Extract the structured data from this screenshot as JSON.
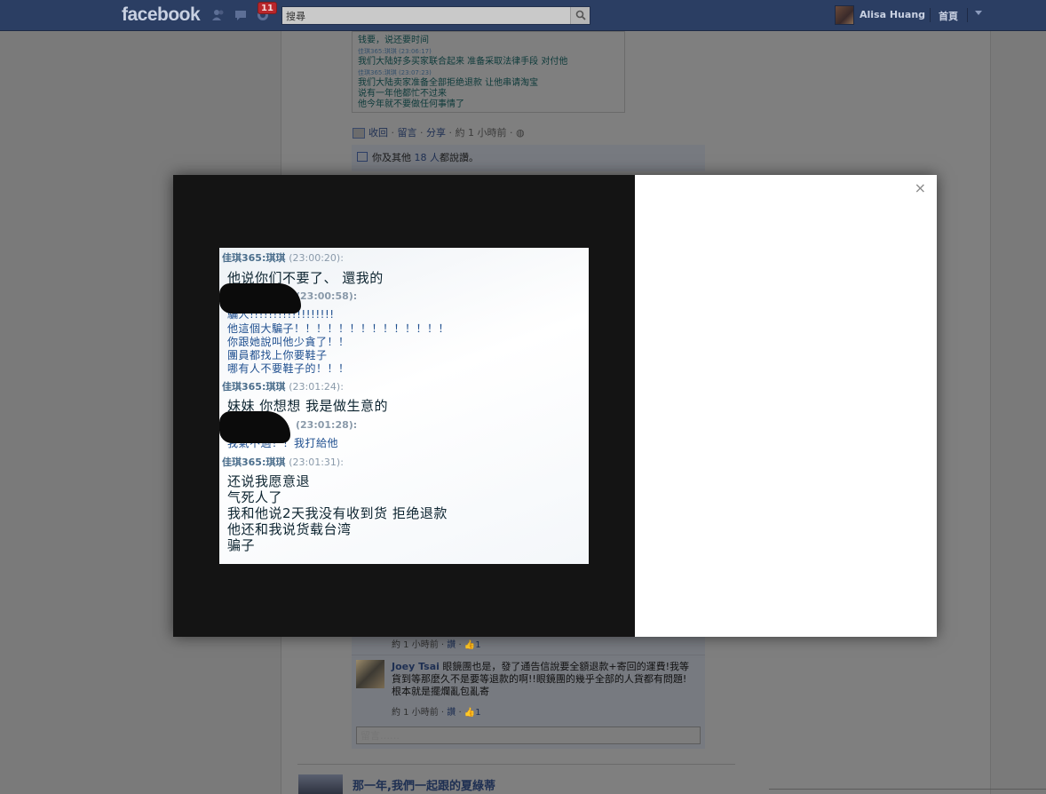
{
  "topbar": {
    "logo": "facebook",
    "notification_count": "11",
    "search": {
      "value": "搜尋",
      "placeholder": "搜尋"
    },
    "user_name": "Alisa Huang",
    "home_label": "首頁"
  },
  "post": {
    "chat_lines": [
      {
        "type": "msg",
        "text": "钱要，说还要时间"
      },
      {
        "type": "name",
        "text": "佳琪365:琪琪 (23:06:17)"
      },
      {
        "type": "msg",
        "text": "我们大陆好多买家联合起来 准备采取法律手段 对付他"
      },
      {
        "type": "name",
        "text": "佳琪365:琪琪 (23:07:23)"
      },
      {
        "type": "msg",
        "text": "我们大陆卖家准备全部拒绝退款 让他串请淘宝"
      },
      {
        "type": "msg",
        "text": "说有一年他都忙不过来"
      },
      {
        "type": "msg",
        "text": "他今年就不要做任何事情了"
      }
    ],
    "actions": {
      "collapse": "收回",
      "comment": "留言",
      "share": "分享",
      "time": "約 1 小時前"
    },
    "likes_text_prefix": "你及其他 ",
    "likes_link": "18 人",
    "likes_text_suffix": "都說讚。"
  },
  "comments": [
    {
      "author": "",
      "text": "",
      "meta_time": "約 1 小時前",
      "meta_like": "讚",
      "meta_count": "1"
    },
    {
      "author": "Joey Tsai",
      "text": "眼鏡團也是，發了通告信說要全額退款+寄回的運費!我等貨到等那麼久不是要等退款的啊!!眼鏡團的幾乎全部的人貨都有問題!根本就是擺爛亂包亂寄",
      "meta_time": "約 1 小時前",
      "meta_like": "讚",
      "meta_count": "1"
    }
  ],
  "comment_input": {
    "placeholder": "留言……"
  },
  "next_post": {
    "title": "那一年,我們一起跟的夏綠蒂"
  },
  "modal": {
    "close": "×",
    "photo_lines": [
      {
        "kind": "name",
        "name": "佳琪365:琪琪",
        "time": "(23:00:20):"
      },
      {
        "kind": "msg",
        "text": "他说你们不要了、   還我的"
      },
      {
        "kind": "time",
        "text": "(23:00:58):"
      },
      {
        "kind": "blue",
        "text": "騙人!!!!!!!!!!!!!!!!!!"
      },
      {
        "kind": "blue",
        "text": "他這個大騙子！！！！！！！！！！！！！！"
      },
      {
        "kind": "blue",
        "text": "你跟她說叫他少貪了！！"
      },
      {
        "kind": "blue",
        "text": "團員都找上你要鞋子"
      },
      {
        "kind": "blue",
        "text": "哪有人不要鞋子的！！！"
      },
      {
        "kind": "name",
        "name": "佳琪365:琪琪",
        "time": "(23:01:24):"
      },
      {
        "kind": "msg",
        "text": "妹妹 你想想  我是做生意的"
      },
      {
        "kind": "time",
        "text": "(23:01:28):"
      },
      {
        "kind": "blue",
        "text": "我氣不過！！我打給他"
      },
      {
        "kind": "name",
        "name": "佳琪365:琪琪",
        "time": "(23:01:31):"
      },
      {
        "kind": "msg",
        "text": "还说我愿意退"
      },
      {
        "kind": "msg",
        "text": "气死人了"
      },
      {
        "kind": "msg",
        "text": "我和他说2天我没有收到货   拒绝退款"
      },
      {
        "kind": "msg",
        "text": "他还和我说货载台湾"
      },
      {
        "kind": "msg",
        "text": "骗子"
      }
    ]
  },
  "colors": {
    "topbar": "#2b3e63",
    "overlay": "#7a7a7a",
    "stage": "#141414",
    "link": "#1e2f52"
  }
}
